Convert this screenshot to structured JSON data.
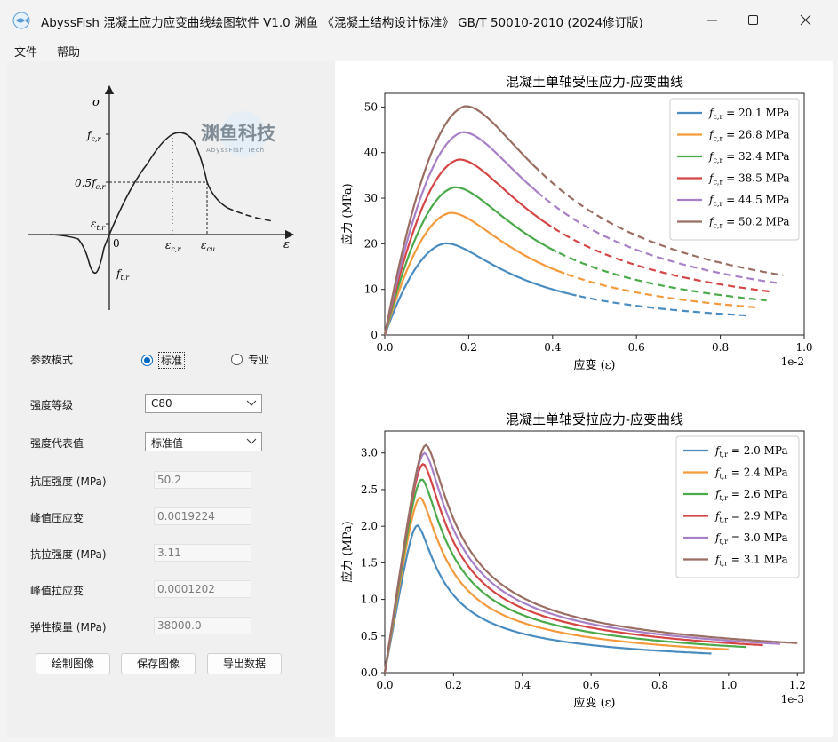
{
  "window": {
    "title": "AbyssFish 混凝土应力应变曲线绘图软件 V1.0 渊鱼 《混凝土结构设计标准》 GB/T 50010-2010 (2024修订版)"
  },
  "menu": {
    "file": "文件",
    "help": "帮助"
  },
  "diagram": {
    "watermark": "渊鱼科技",
    "watermark_sub": "AbyssFish Tech",
    "labels": {
      "sigma": "σ",
      "fc": "f",
      "fc_sub": "c,r",
      "half_fc": "0.5f",
      "half_fc_sub": "c,r",
      "eps_t": "ε",
      "eps_t_sub": "t,r",
      "zero": "0",
      "eps_c": "ε",
      "eps_c_sub": "c,r",
      "eps_cu": "ε",
      "eps_cu_sub": "cu",
      "eps": "ε",
      "ft": "f",
      "ft_sub": "t,r"
    }
  },
  "form": {
    "mode_label": "参数模式",
    "mode_standard": "标准",
    "mode_pro": "专业",
    "grade_label": "强度等级",
    "grade_value": "C80",
    "rep_label": "强度代表值",
    "rep_value": "标准值",
    "fc_label": "抗压强度 (MPa)",
    "fc_value": "50.2",
    "eps_c_label": "峰值压应变",
    "eps_c_value": "0.0019224",
    "ft_label": "抗拉强度 (MPa)",
    "ft_value": "3.11",
    "eps_t_label": "峰值拉应变",
    "eps_t_value": "0.0001202",
    "E_label": "弹性模量 (MPa)",
    "E_value": "38000.0"
  },
  "buttons": {
    "draw": "绘制图像",
    "save": "保存图像",
    "export": "导出数据"
  },
  "chart_data": [
    {
      "type": "line",
      "title": "混凝土单轴受压应力-应变曲线",
      "xlabel": "应变 (ε)",
      "ylabel": "应力 (MPa)",
      "x_offset_label": "1e-2",
      "xlim": [
        0,
        1.0
      ],
      "ylim": [
        0,
        53
      ],
      "xticks": [
        "0.0",
        "0.2",
        "0.4",
        "0.6",
        "0.8",
        "1.0"
      ],
      "yticks": [
        "0",
        "10",
        "20",
        "30",
        "40",
        "50"
      ],
      "xtick_values": [
        0,
        0.2,
        0.4,
        0.6,
        0.8,
        1.0
      ],
      "ytick_values": [
        0,
        10,
        20,
        30,
        40,
        50
      ],
      "legend_position": "top-right",
      "series": [
        {
          "name": "20.1 MPa",
          "legend_sym": "f",
          "legend_sub": "c,r",
          "color": "#4a8cc0",
          "fc": 20.1,
          "peak": 0.145,
          "ecu": 0.46,
          "xend": 0.87
        },
        {
          "name": "26.8 MPa",
          "legend_sym": "f",
          "legend_sub": "c,r",
          "color": "#f59a3c",
          "fc": 26.8,
          "peak": 0.157,
          "ecu": 0.43,
          "xend": 0.89
        },
        {
          "name": "32.4 MPa",
          "legend_sym": "f",
          "legend_sub": "c,r",
          "color": "#4aaa4a",
          "fc": 32.4,
          "peak": 0.167,
          "ecu": 0.41,
          "xend": 0.91
        },
        {
          "name": "38.5 MPa",
          "legend_sym": "f",
          "legend_sub": "c,r",
          "color": "#d64545",
          "fc": 38.5,
          "peak": 0.177,
          "ecu": 0.4,
          "xend": 0.92
        },
        {
          "name": "44.5 MPa",
          "legend_sym": "f",
          "legend_sub": "c,r",
          "color": "#a880c8",
          "fc": 44.5,
          "peak": 0.186,
          "ecu": 0.38,
          "xend": 0.94
        },
        {
          "name": "50.2 MPa",
          "legend_sym": "f",
          "legend_sub": "c,r",
          "color": "#9a6e62",
          "fc": 50.2,
          "peak": 0.192,
          "ecu": 0.37,
          "xend": 0.95
        }
      ]
    },
    {
      "type": "line",
      "title": "混凝土单轴受拉应力-应变曲线",
      "xlabel": "应变 (ε)",
      "ylabel": "应力 (MPa)",
      "x_offset_label": "1e-3",
      "xlim": [
        0,
        1.22
      ],
      "ylim": [
        0,
        3.3
      ],
      "xticks": [
        "0.0",
        "0.2",
        "0.4",
        "0.6",
        "0.8",
        "1.0",
        "1.2"
      ],
      "yticks": [
        "0.0",
        "0.5",
        "1.0",
        "1.5",
        "2.0",
        "2.5",
        "3.0"
      ],
      "xtick_values": [
        0,
        0.2,
        0.4,
        0.6,
        0.8,
        1.0,
        1.2
      ],
      "ytick_values": [
        0,
        0.5,
        1.0,
        1.5,
        2.0,
        2.5,
        3.0
      ],
      "legend_position": "top-right",
      "series": [
        {
          "name": "2.0 MPa",
          "legend_sym": "f",
          "legend_sub": "t,r",
          "color": "#4a8cc0",
          "ft": 2.01,
          "peak": 0.095,
          "xend": 0.95,
          "yend": 0.32
        },
        {
          "name": "2.4 MPa",
          "legend_sym": "f",
          "legend_sub": "t,r",
          "color": "#f59a3c",
          "ft": 2.39,
          "peak": 0.103,
          "xend": 1.0,
          "yend": 0.3
        },
        {
          "name": "2.6 MPa",
          "legend_sym": "f",
          "legend_sub": "t,r",
          "color": "#4aaa4a",
          "ft": 2.64,
          "peak": 0.108,
          "xend": 1.05,
          "yend": 0.28
        },
        {
          "name": "2.9 MPa",
          "legend_sym": "f",
          "legend_sub": "t,r",
          "color": "#d64545",
          "ft": 2.85,
          "peak": 0.112,
          "xend": 1.1,
          "yend": 0.26
        },
        {
          "name": "3.0 MPa",
          "legend_sym": "f",
          "legend_sub": "t,r",
          "color": "#a880c8",
          "ft": 3.0,
          "peak": 0.116,
          "xend": 1.15,
          "yend": 0.245
        },
        {
          "name": "3.1 MPa",
          "legend_sym": "f",
          "legend_sub": "t,r",
          "color": "#9a6e62",
          "ft": 3.11,
          "peak": 0.12,
          "xend": 1.2,
          "yend": 0.23
        }
      ]
    }
  ]
}
